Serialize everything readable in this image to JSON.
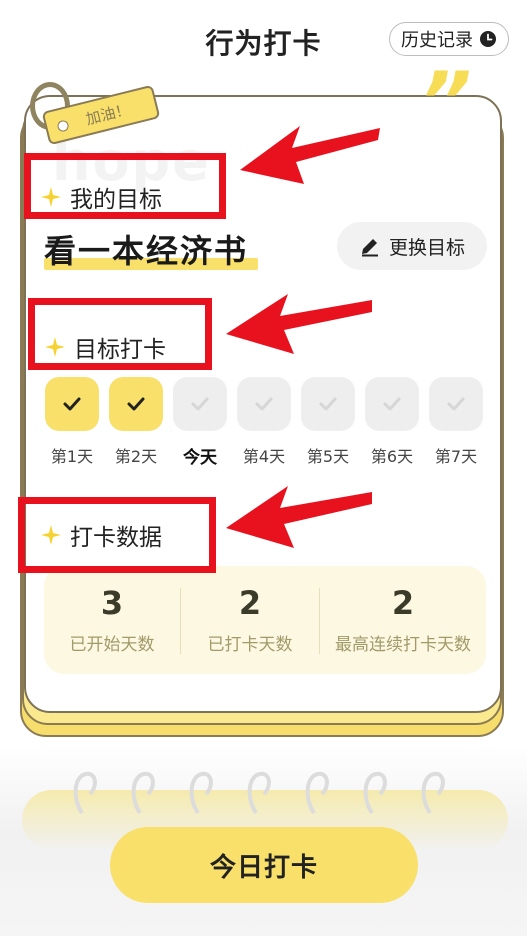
{
  "header": {
    "title": "行为打卡",
    "history_label": "历史记录"
  },
  "card": {
    "tag_label": "加油！",
    "watermark": "hope",
    "goal": {
      "section_title": "我的目标",
      "text": "看一本经济书",
      "change_label": "更换目标"
    },
    "checkin": {
      "section_title": "目标打卡",
      "days": [
        {
          "label": "第1天",
          "status": "done"
        },
        {
          "label": "第2天",
          "status": "done"
        },
        {
          "label": "今天",
          "status": "today"
        },
        {
          "label": "第4天",
          "status": "todo"
        },
        {
          "label": "第5天",
          "status": "todo"
        },
        {
          "label": "第6天",
          "status": "todo"
        },
        {
          "label": "第7天",
          "status": "todo"
        }
      ]
    },
    "stats": {
      "section_title": "打卡数据",
      "items": [
        {
          "value": "3",
          "label": "已开始天数"
        },
        {
          "value": "2",
          "label": "已打卡天数"
        },
        {
          "value": "2",
          "label": "最高连续打卡天数"
        }
      ]
    }
  },
  "footer": {
    "checkin_button": "今日打卡"
  },
  "colors": {
    "accent": "#f8e06b",
    "annotation": "#e8121f"
  },
  "icons": {
    "history": "clock-icon",
    "change": "pencil-icon",
    "section": "sparkle-star-icon",
    "day_done": "check-icon"
  }
}
